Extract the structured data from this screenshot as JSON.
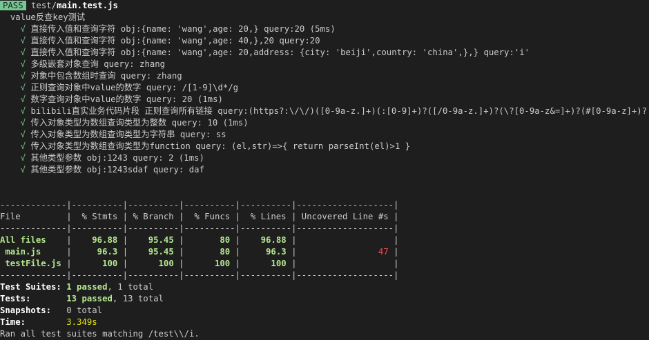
{
  "header": {
    "badge": "PASS",
    "path_dir": "test/",
    "path_file": "main.test.js"
  },
  "suite_name": "value反查key测试",
  "tests": [
    "直接传入值和查询字符 obj:{name: 'wang',age: 20,} query:20 (5ms)",
    "直接传入值和查询字符 obj:{name: 'wang',age: 40,},20 query:20",
    "直接传入值和查询字符 obj:{name: 'wang',age: 20,address: {city: 'beiji',country: 'china',},} query:'i'",
    "多级嵌套对象查询 query: zhang",
    "对象中包含数组时查询 query: zhang",
    "正则查询对象中value的数字 query: /[1-9]\\d*/g",
    "数字查询对象中value的数字 query: 20 (1ms)",
    "bilibili直实业务代码片段 正则查询所有链接 query:(https?:\\/\\/)([0-9a-z.]+)(:[0-9]+)?([/0-9a-z.]+)?(\\?[0-9a-z&=]+)?(#[0-9a-z]+)?",
    "传入对象类型为数组查询类型为整数 query: 10 (1ms)",
    "传入对象类型为数组查询类型为字符串 query: ss",
    "传入对象类型为数组查询类型为function query: (el,str)=>{ return parseInt(el)>1 }",
    "其他类型参数 obj:1243 query: 2 (1ms)",
    "其他类型参数 obj:1243sdaf query: daf"
  ],
  "check_glyph": "√",
  "coverage": {
    "separator": "-------------|----------|----------|----------|----------|-------------------|",
    "header_line": "File         |  % Stmts | % Branch |  % Funcs |  % Lines | Uncovered Line #s |",
    "rows": [
      {
        "name": "All files    ",
        "stmts": "96.88",
        "branch": "95.45",
        "funcs": "80",
        "lines": "96.88",
        "uncovered": ""
      },
      {
        "name": " main.js     ",
        "stmts": "96.3",
        "branch": "95.45",
        "funcs": "80",
        "lines": "96.3",
        "uncovered": "47"
      },
      {
        "name": " testFile.js ",
        "stmts": "100",
        "branch": "100",
        "funcs": "100",
        "lines": "100",
        "uncovered": ""
      }
    ]
  },
  "summary": {
    "suites_label": "Test Suites:",
    "suites_passed": "1 passed",
    "suites_total": ", 1 total",
    "tests_label": "Tests:",
    "tests_passed": "13 passed",
    "tests_total": ", 13 total",
    "snapshots_label": "Snapshots:",
    "snapshots_value": "0 total",
    "time_label": "Time:",
    "time_value": "3.349s",
    "ran_line": "Ran all test suites matching /test\\\\/i."
  },
  "colors": {
    "background": "#1e1e1e",
    "pass": "#73c991",
    "green": "#b5e890",
    "red": "#f14c4c",
    "yellow": "#e5e510"
  }
}
